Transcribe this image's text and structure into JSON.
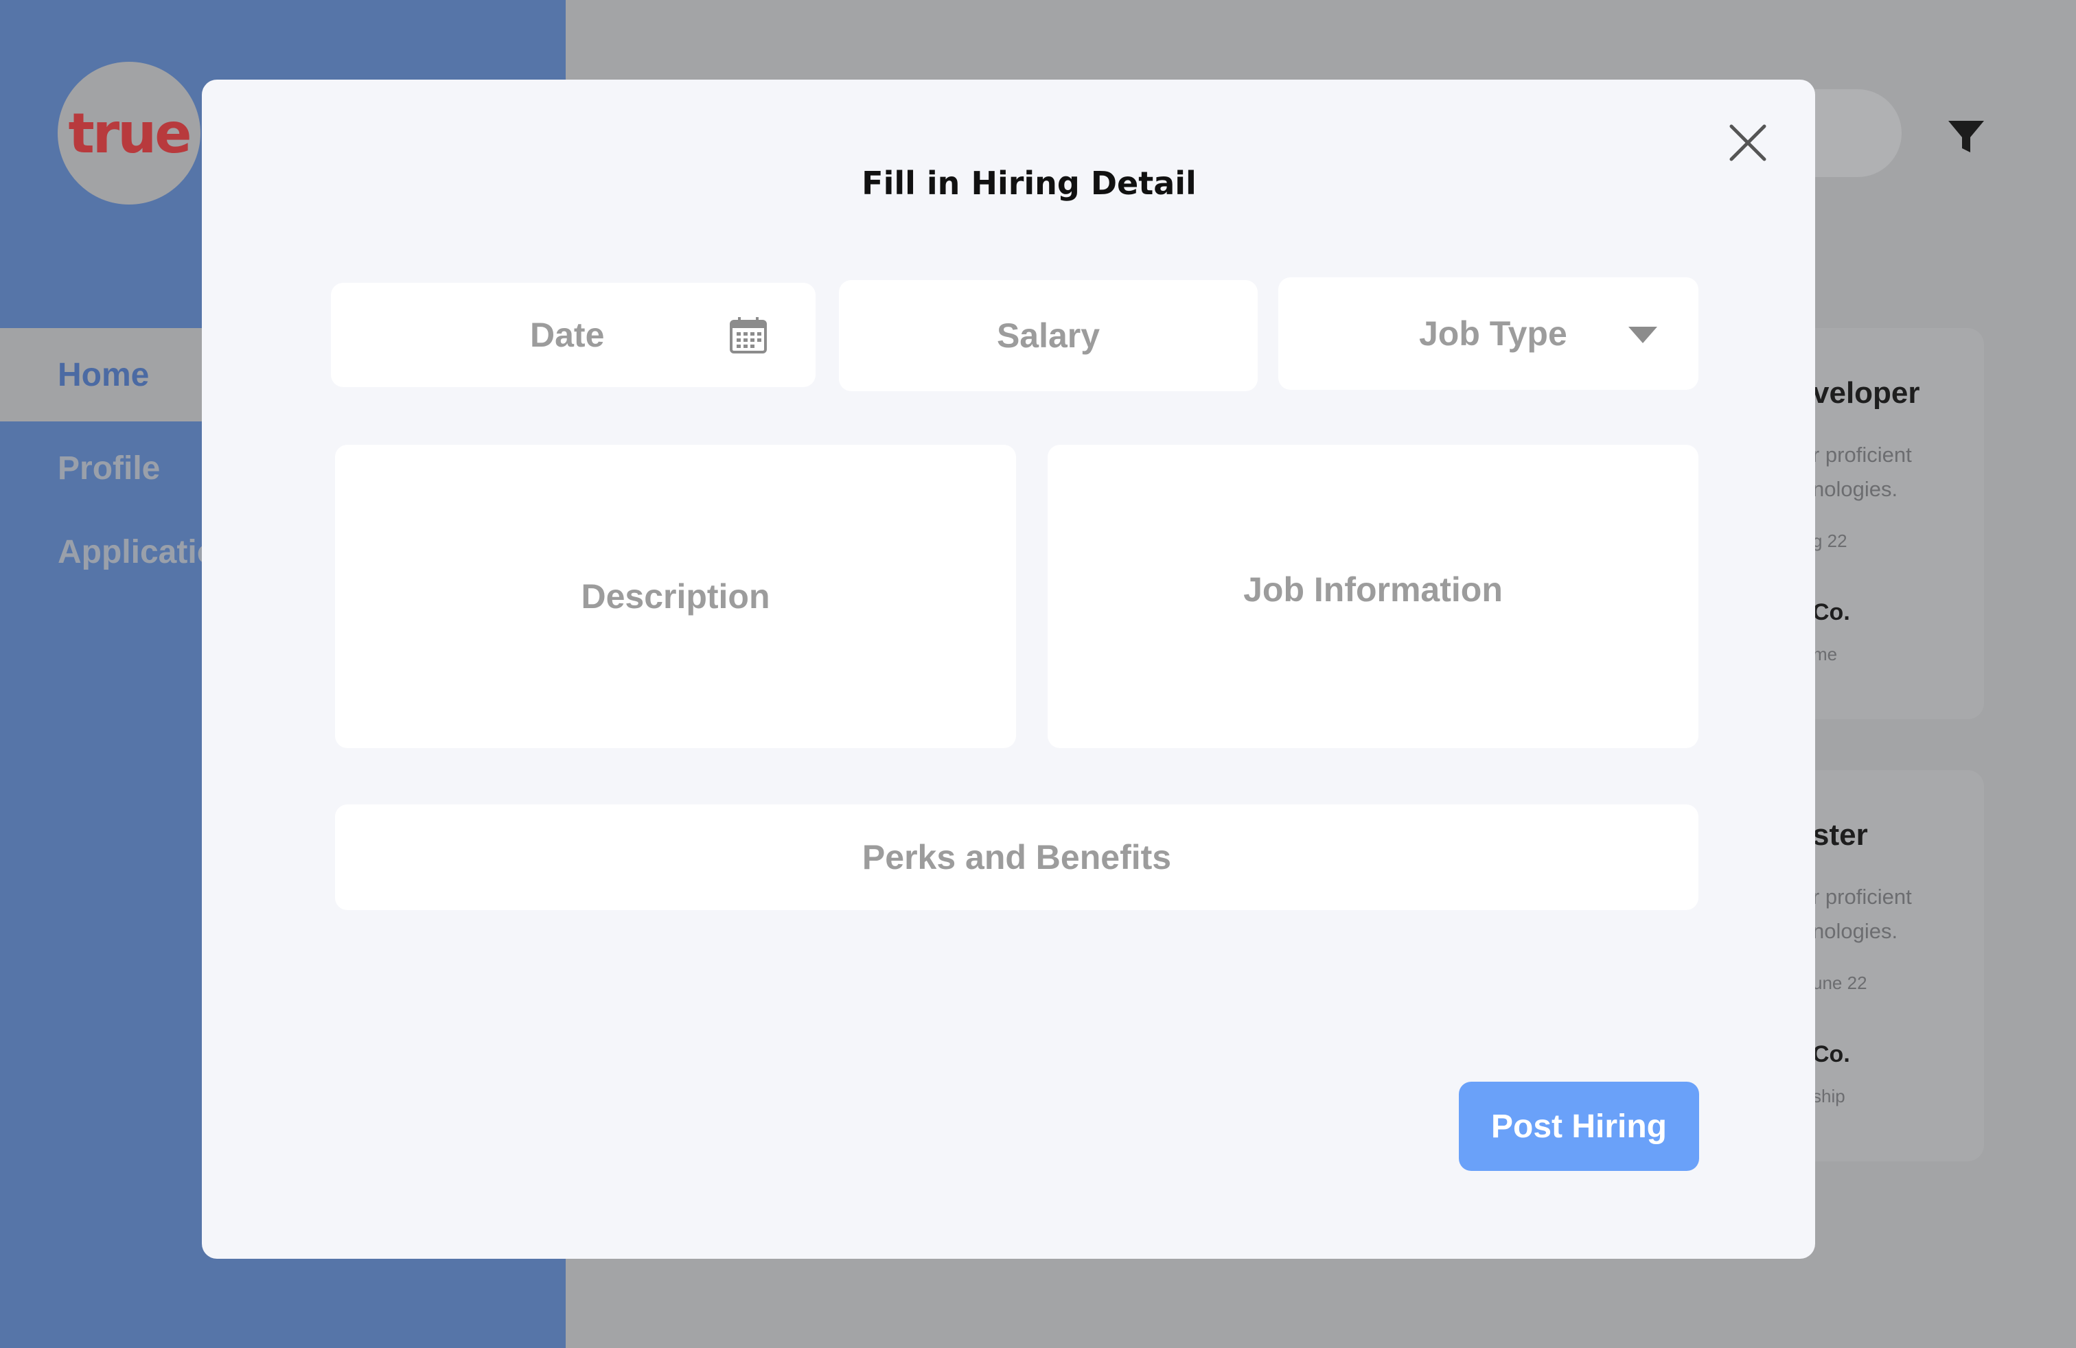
{
  "brand": {
    "logo_text": "true"
  },
  "sidebar": {
    "items": [
      {
        "label": "Home",
        "active": true
      },
      {
        "label": "Profile"
      },
      {
        "label": "Applicatio"
      }
    ]
  },
  "background_cards": [
    {
      "title": "veloper",
      "desc_line1": "r proficient",
      "desc_line2": "nologies.",
      "date": "g 22",
      "company": "Co.",
      "type": "me"
    },
    {
      "title": "ster",
      "desc_line1": "r proficient",
      "desc_line2": "nologies.",
      "date": "une 22",
      "company": "Co.",
      "type": "ship"
    }
  ],
  "modal": {
    "title": "Fill in Hiring Detail",
    "fields": {
      "date_placeholder": "Date",
      "salary_placeholder": "Salary",
      "job_type_placeholder": "Job Type",
      "description_placeholder": "Description",
      "job_information_placeholder": "Job Information",
      "perks_placeholder": "Perks and Benefits"
    },
    "post_button_label": "Post Hiring"
  },
  "icons": {
    "close": "close-icon",
    "calendar": "calendar-icon",
    "dropdown": "chevron-down-icon",
    "filter": "filter-icon"
  },
  "colors": {
    "sidebar": "#5675a8",
    "accent_button": "#6aa1f9",
    "logo_red": "#b83a3d"
  }
}
